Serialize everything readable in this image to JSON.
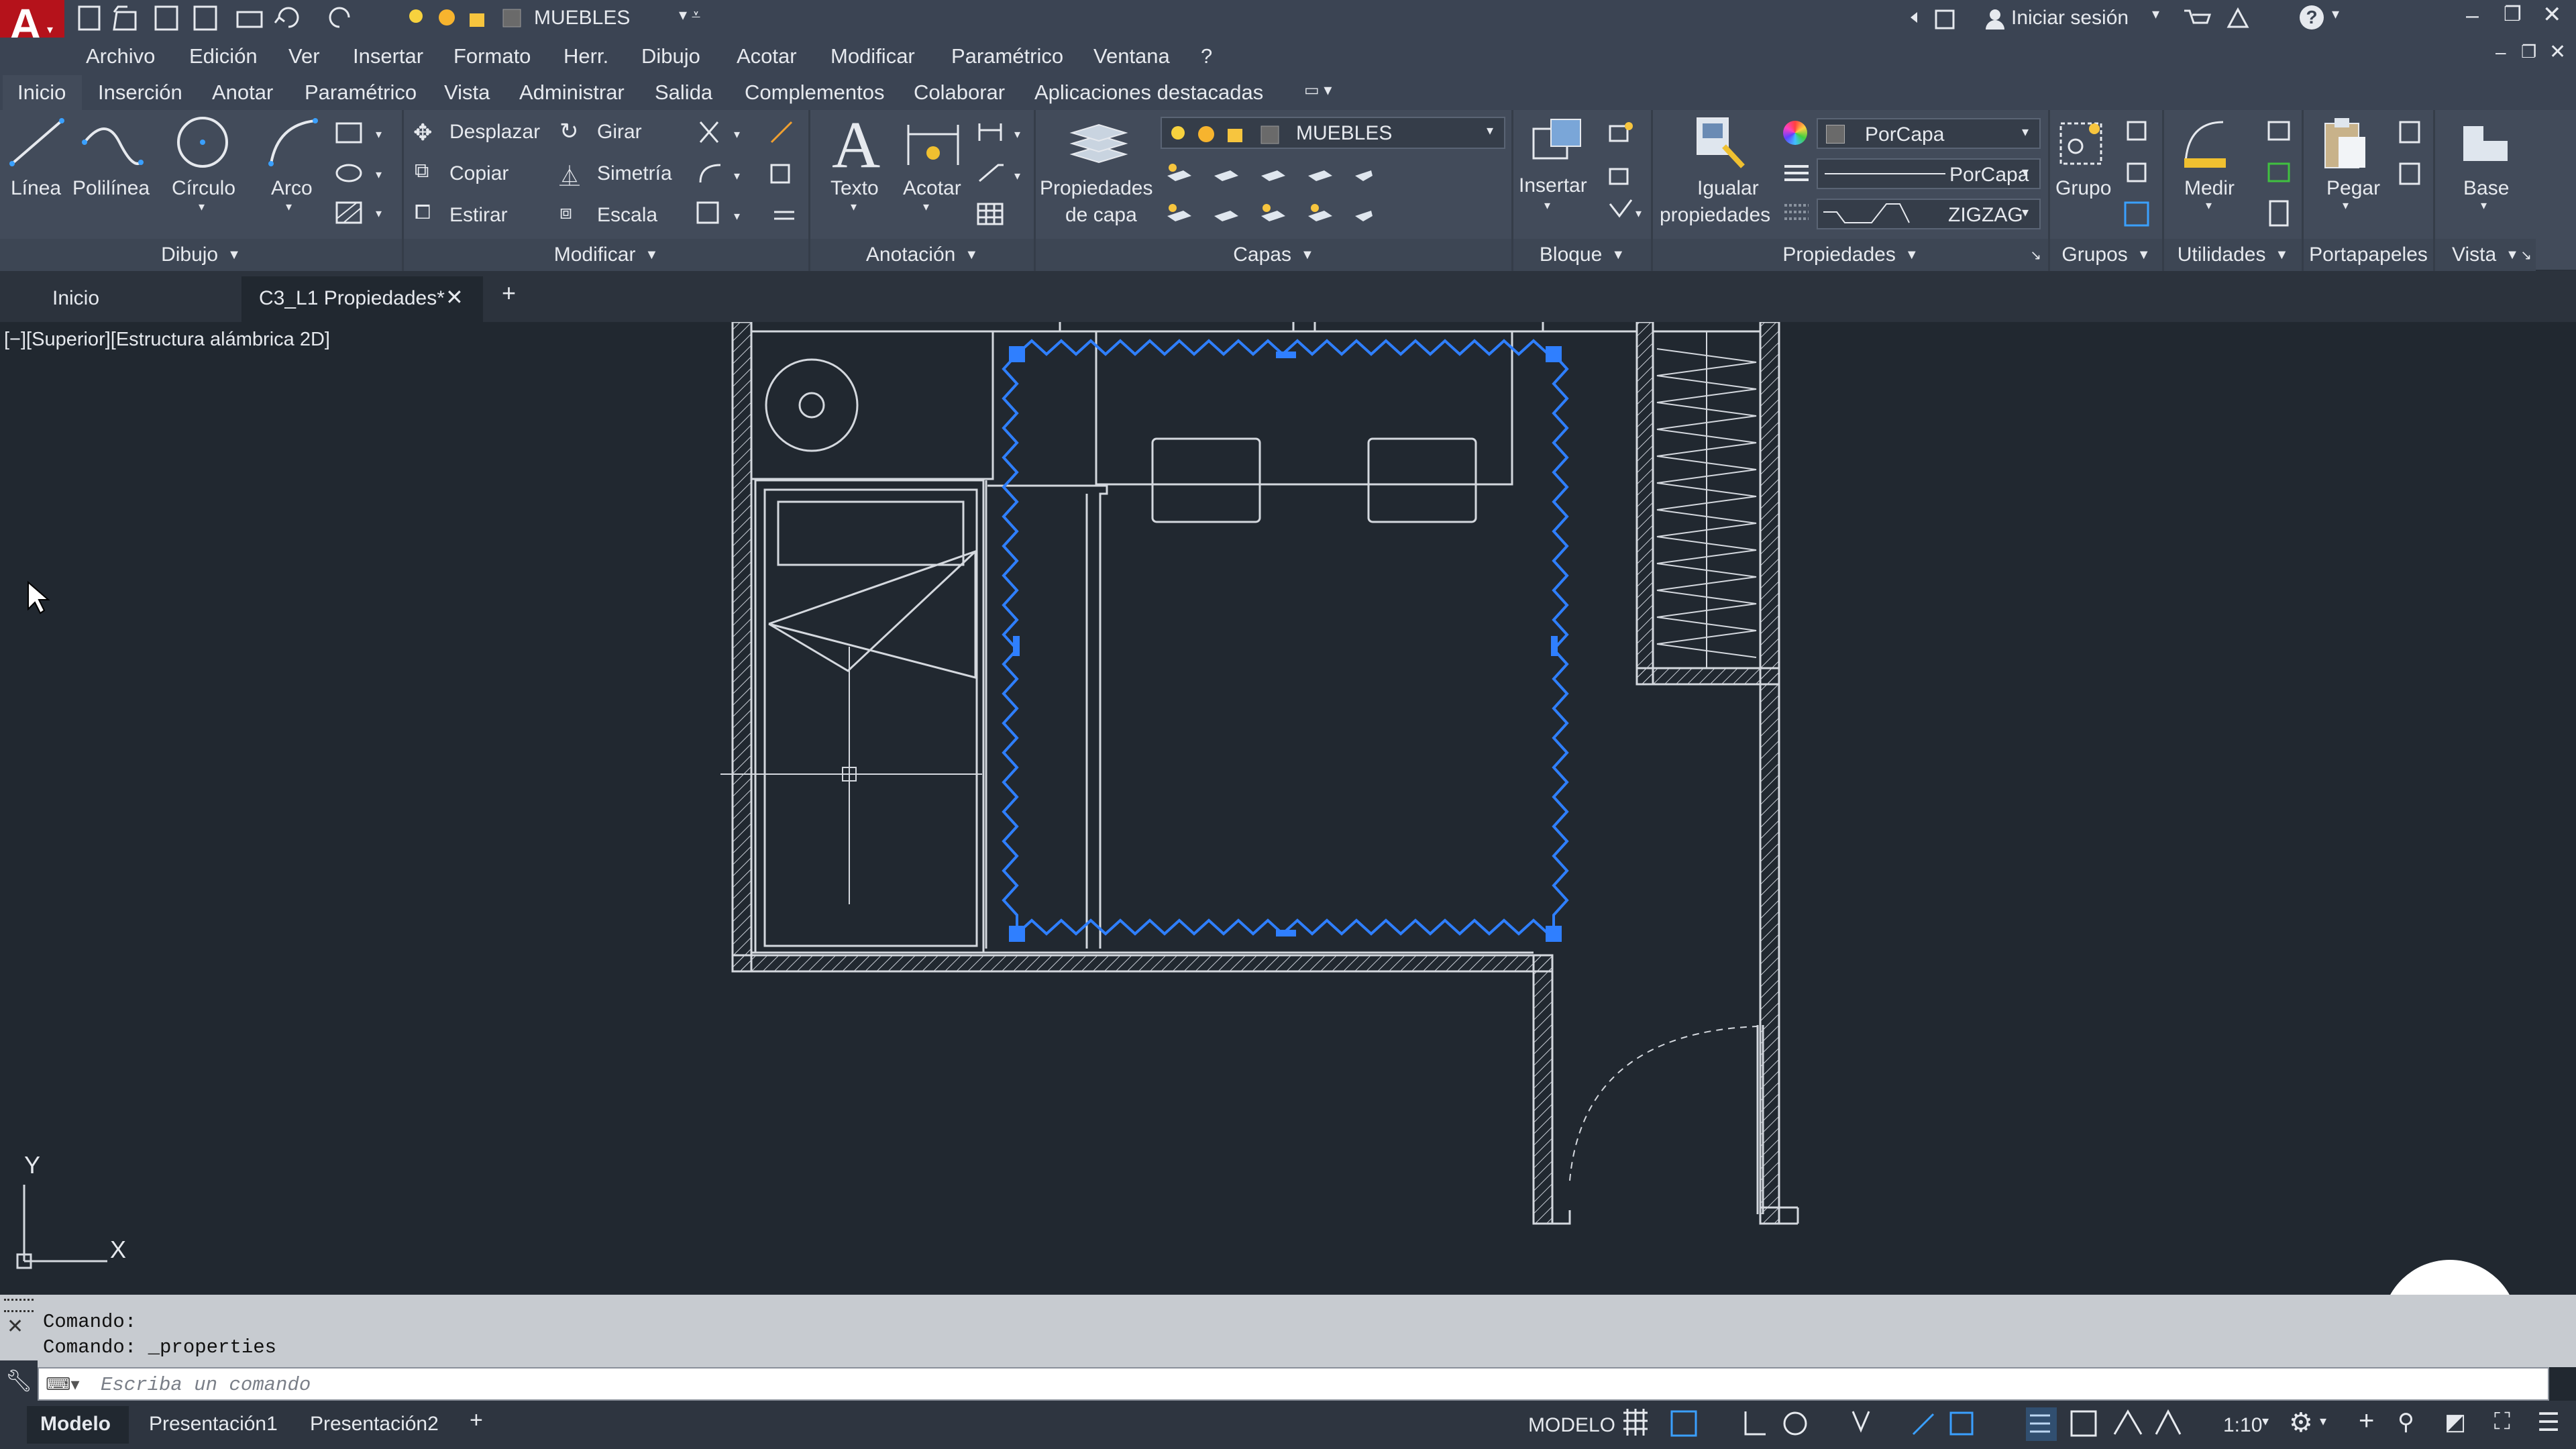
{
  "app": {
    "logo_letter": "A",
    "current_layer": "MUEBLES"
  },
  "titlebar": {
    "signin": "Iniciar sesión",
    "help_icon": "help-icon"
  },
  "menubar": {
    "items": [
      "Archivo",
      "Edición",
      "Ver",
      "Insertar",
      "Formato",
      "Herr.",
      "Dibujo",
      "Acotar",
      "Modificar",
      "Paramétrico",
      "Ventana",
      "?"
    ]
  },
  "ribbon_tabs": {
    "items": [
      "Inicio",
      "Inserción",
      "Anotar",
      "Paramétrico",
      "Vista",
      "Administrar",
      "Salida",
      "Complementos",
      "Colaborar",
      "Aplicaciones destacadas"
    ],
    "active": "Inicio"
  },
  "ribbon": {
    "dibujo": {
      "title": "Dibujo",
      "linea": "Línea",
      "polilinea": "Polilínea",
      "circulo": "Círculo",
      "arco": "Arco"
    },
    "modificar": {
      "title": "Modificar",
      "desplazar": "Desplazar",
      "girar": "Girar",
      "copiar": "Copiar",
      "simetria": "Simetría",
      "estirar": "Estirar",
      "escala": "Escala"
    },
    "anotacion": {
      "title": "Anotación",
      "texto": "Texto",
      "acotar": "Acotar"
    },
    "capas": {
      "title": "Capas",
      "propiedades_l1": "Propiedades",
      "propiedades_l2": "de capa",
      "layer": "MUEBLES"
    },
    "bloque": {
      "title": "Bloque",
      "insertar": "Insertar"
    },
    "propiedades": {
      "title": "Propiedades",
      "igualar_l1": "Igualar",
      "igualar_l2": "propiedades",
      "color": "PorCapa",
      "linetype": "PorCapa",
      "lineweight": "ZIGZAG"
    },
    "grupos": {
      "title": "Grupos",
      "grupo": "Grupo"
    },
    "utilidades": {
      "title": "Utilidades",
      "medir": "Medir"
    },
    "portapapeles": {
      "title": "Portapapeles",
      "pegar": "Pegar"
    },
    "vista": {
      "title": "Vista",
      "base": "Base"
    }
  },
  "doc_tabs": {
    "start": "Inicio",
    "active": "C3_L1 Propiedades*"
  },
  "viewport": {
    "label": "[−][Superior][Estructura alámbrica 2D]",
    "ucs_x": "X",
    "ucs_y": "Y",
    "selection_color": "#2f7fff"
  },
  "command": {
    "lines": [
      "Comando:",
      "Comando: _properties"
    ],
    "placeholder": "Escriba un comando"
  },
  "layout_tabs": {
    "items": [
      "Modelo",
      "Presentación1",
      "Presentación2"
    ],
    "active": "Modelo"
  },
  "status": {
    "mode": "MODELO",
    "scale": "1:10"
  },
  "colors": {
    "accent": "#2f7fff",
    "logo_red": "#c8102e",
    "ribbon_bg": "#424b5a",
    "canvas": "#212830"
  }
}
